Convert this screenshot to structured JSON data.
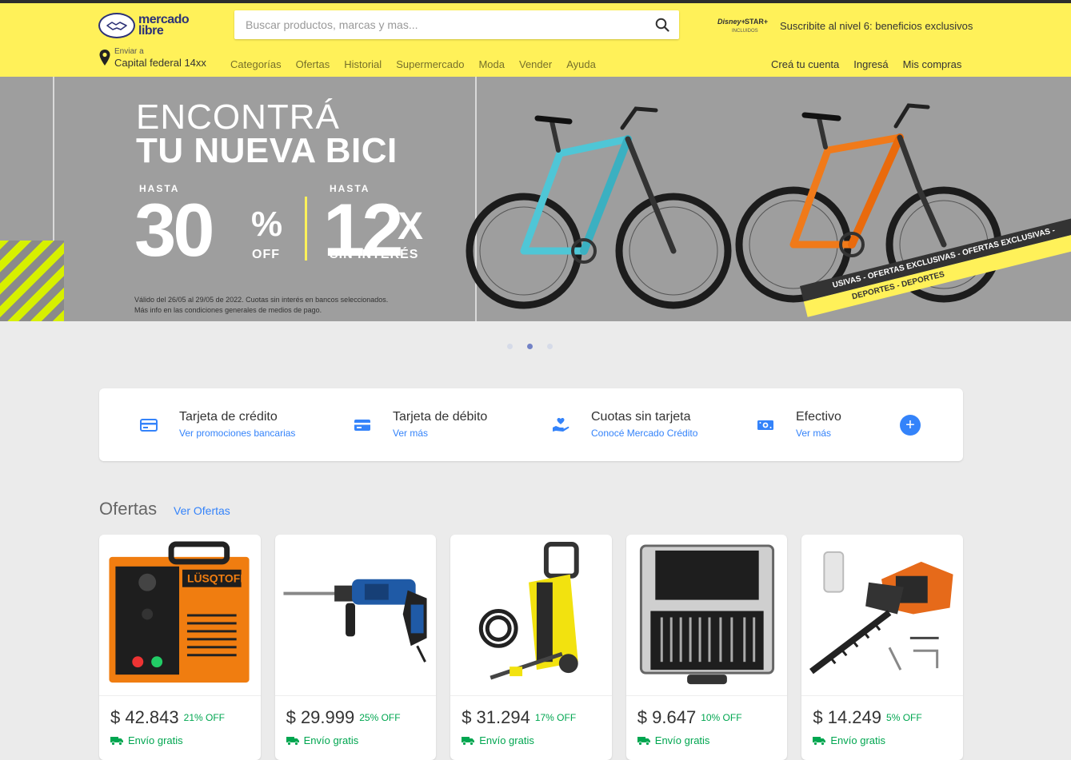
{
  "header": {
    "logo_line1": "mercado",
    "logo_line2": "libre",
    "search_placeholder": "Buscar productos, marcas y mas...",
    "disney_brand": "Disney+",
    "star_brand": "STAR+",
    "disney_sub": "INCLUIDOS",
    "promo_text": "Suscribite al nivel 6: beneficios exclusivos",
    "ship_label": "Enviar a",
    "ship_location": "Capital federal 14xx",
    "nav": [
      "Categorías",
      "Ofertas",
      "Historial",
      "Supermercado",
      "Moda",
      "Vender",
      "Ayuda"
    ],
    "account": [
      "Creá tu cuenta",
      "Ingresá",
      "Mis compras"
    ]
  },
  "banner": {
    "title_line1": "ENCONTRÁ",
    "title_line2": "TU NUEVA BICI",
    "hasta1": "HASTA",
    "discount_number": "30",
    "discount_pct": "%",
    "discount_off": "OFF",
    "hasta2": "HASTA",
    "installments_number": "12",
    "installments_x": "X",
    "installments_label": "SIN INTERÉS",
    "legal_line1": "Válido del 26/05 al 29/05 de 2022. Cuotas sin interés en bancos seleccionados.",
    "legal_line2": "Más info en las condiciones generales de medios de pago.",
    "ribbon_dark": "USIVAS - OFERTAS EXCLUSIVAS - OFERTAS EXCLUSIVAS -",
    "ribbon_yellow": "DEPORTES - DEPORTES",
    "slides": 3,
    "active_slide": 1,
    "bike1_color": "#4fc6d6",
    "bike2_color": "#f07a1a"
  },
  "payments": [
    {
      "title": "Tarjeta de crédito",
      "link": "Ver promociones bancarias",
      "icon": "credit-card-icon"
    },
    {
      "title": "Tarjeta de débito",
      "link": "Ver más",
      "icon": "debit-card-icon"
    },
    {
      "title": "Cuotas sin tarjeta",
      "link": "Conocé Mercado Crédito",
      "icon": "hand-heart-icon"
    },
    {
      "title": "Efectivo",
      "link": "Ver más",
      "icon": "cash-icon"
    }
  ],
  "payments_more": "+",
  "ofertas": {
    "title": "Ofertas",
    "link": "Ver Ofertas",
    "products": [
      {
        "price": "$ 42.843",
        "discount": "21% OFF",
        "shipping": "Envío gratis",
        "image": "welder-machine"
      },
      {
        "price": "$ 29.999",
        "discount": "25% OFF",
        "shipping": "Envío gratis",
        "image": "rotary-hammer-drill"
      },
      {
        "price": "$ 31.294",
        "discount": "17% OFF",
        "shipping": "Envío gratis",
        "image": "pressure-washer"
      },
      {
        "price": "$ 9.647",
        "discount": "10% OFF",
        "shipping": "Envío gratis",
        "image": "drill-bit-case"
      },
      {
        "price": "$ 14.249",
        "discount": "5% OFF",
        "shipping": "Envío gratis",
        "image": "hedge-trimmer"
      }
    ]
  },
  "colors": {
    "header_bg": "#fff159",
    "link_blue": "#3483fa",
    "green": "#00a650",
    "page_bg": "#ebebeb"
  }
}
